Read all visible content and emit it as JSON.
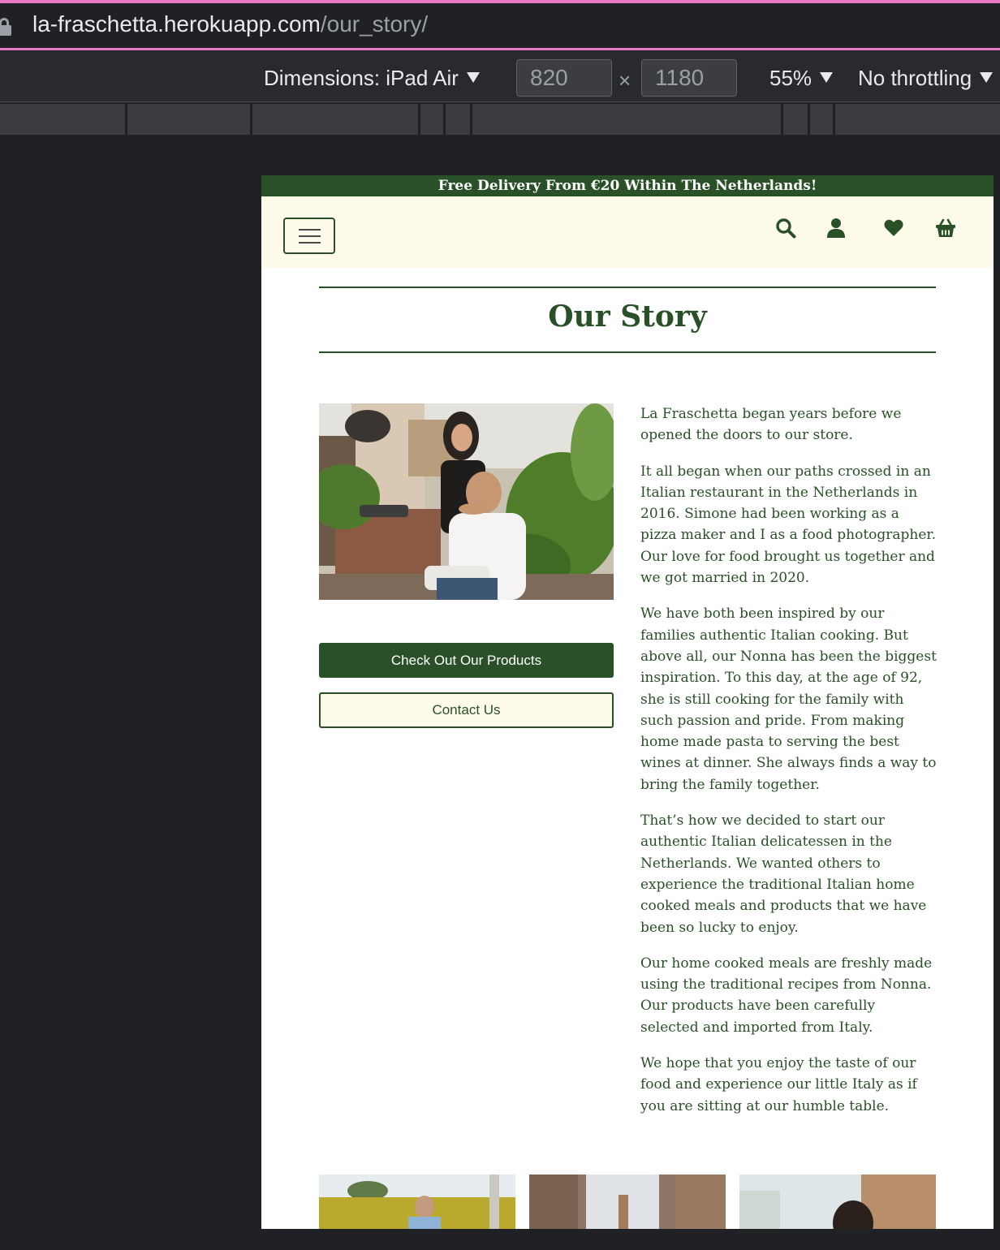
{
  "browser": {
    "url_host": "la-fraschetta.herokuapp.com",
    "url_path": "/our_story/"
  },
  "devtools": {
    "dimensions_label": "Dimensions: iPad Air",
    "width_value": "820",
    "height_value": "1180",
    "times_symbol": "×",
    "zoom": "55%",
    "throttling": "No throttling"
  },
  "site": {
    "promo_banner": "Free Delivery From €20 Within The Netherlands!",
    "nav_icons": [
      "menu-icon",
      "search-icon",
      "user-icon",
      "heart-icon",
      "basket-icon"
    ],
    "page_title": "Our Story",
    "buttons": {
      "products": "Check Out Our Products",
      "contact": "Contact Us"
    },
    "story_paragraphs": [
      "La Fraschetta began years before we opened the doors to our store.",
      "It all began when our paths crossed in an Italian restaurant in the Netherlands in 2016. Simone had been working as a pizza maker and I as a food photographer. Our love for food brought us together and we got married in 2020.",
      "We have both been inspired by our families authentic Italian cooking. But above all, our Nonna has been the biggest inspiration. To this day, at the age of 92, she is still cooking for the family with such passion and pride. From making home made pasta to serving the best wines at dinner. She always finds a way to bring the family together.",
      "That’s how we decided to start our authentic Italian delicatessen in the Netherlands. We wanted others to experience the traditional Italian home cooked meals and products that we have been so lucky to enjoy.",
      "Our home cooked meals are freshly made using the traditional recipes from Nonna. Our products have been carefully selected and imported from Italy.",
      "We hope that you enjoy the taste of our food and experience our little Italy as if you are sitting at our humble table."
    ]
  },
  "colors": {
    "brand_green": "#2a5027",
    "cream": "#fefbea",
    "chrome_dark": "#202124",
    "focus_pink": "#e879c5"
  }
}
